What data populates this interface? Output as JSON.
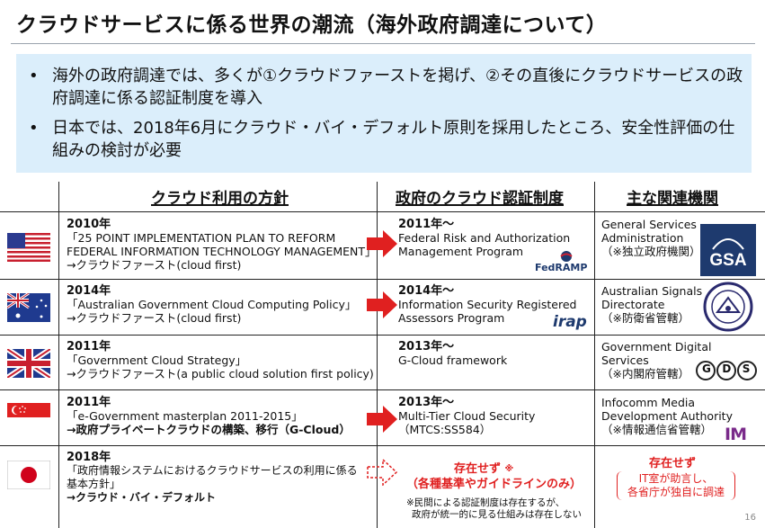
{
  "title": "クラウドサービスに係る世界の潮流（海外政府調達について）",
  "summary": {
    "bullets": [
      {
        "dot": "•",
        "text": "海外の政府調達では、多くが①クラウドファーストを掲げ、②その直後にクラウドサービスの政府調達に係る認証制度を導入"
      },
      {
        "dot": "•",
        "text": "日本では、2018年6月にクラウド・バイ・デフォルト原則を採用したところ、安全性評価の仕組みの検討が必要"
      }
    ]
  },
  "table": {
    "headers": {
      "policy": "クラウド利用の方針",
      "certification": "政府のクラウド認証制度",
      "agency": "主な関連機関"
    },
    "rows": [
      {
        "country": "usa-flag",
        "policy_year": "2010年",
        "policy_lines": [
          "「25 POINT IMPLEMENTATION PLAN TO REFORM",
          "FEDERAL INFORMATION TECHNOLOGY MANAGEMENT」",
          "→クラウドファースト(cloud first)"
        ],
        "cert_year": "2011年～",
        "cert_lines": [
          "Federal Risk and Authorization",
          "Management Program"
        ],
        "cert_logo": "FedRAMP",
        "agency_lines": [
          "General Services",
          "Administration",
          "（※独立政府機関）"
        ],
        "agency_logo": "GSA"
      },
      {
        "country": "australia-flag",
        "policy_year": "2014年",
        "policy_lines": [
          "「Australian Government Cloud Computing Policy」",
          "→クラウドファースト(cloud first)"
        ],
        "cert_year": "2014年～",
        "cert_lines": [
          "Information Security Registered",
          "Assessors Program"
        ],
        "cert_logo": "irap",
        "agency_lines": [
          "Australian Signals",
          "Directorate",
          "（※防衛省管轄）"
        ],
        "agency_logo": "ASD"
      },
      {
        "country": "uk-flag",
        "policy_year": "2011年",
        "policy_lines": [
          "「Government Cloud Strategy」",
          "→クラウドファースト(a public cloud solution first policy)"
        ],
        "cert_year": "2013年～",
        "cert_lines": [
          "G-Cloud  framework"
        ],
        "cert_logo": "",
        "agency_lines": [
          "Government Digital",
          "Services",
          "（※内閣府管轄）"
        ],
        "agency_logo": "GDS"
      },
      {
        "country": "singapore-flag",
        "policy_year": "2011年",
        "policy_lines": [
          "「e-Government masterplan 2011-2015」",
          "→政府プライベートクラウドの構築、移行（G-Cloud）"
        ],
        "cert_year": "2013年～",
        "cert_lines": [
          "Multi-Tier Cloud Security",
          "（MTCS:SS584）"
        ],
        "cert_logo": "",
        "agency_lines": [
          "Infocomm Media",
          "Development Authority",
          "（※情報通信省管轄）"
        ],
        "agency_logo": "IM"
      },
      {
        "country": "japan-flag",
        "policy_year": "2018年",
        "policy_lines": [
          "「政府情報システムにおけるクラウドサービスの利用に係る",
          "基本方針」",
          "→クラウド・バイ・デフォルト"
        ],
        "cert_status": "存在せず",
        "cert_status_mark": "※",
        "cert_detail": "（各種基準やガイドラインのみ）",
        "cert_note_lines": [
          "※民間による認証制度は存在するが、",
          "政府が統一的に見る仕組みは存在しない"
        ],
        "agency_status": "存在せず",
        "agency_detail_lines": [
          "IT室が助言し、",
          "各省庁が独自に調達"
        ]
      }
    ]
  },
  "page_number": "16",
  "colors": {
    "accent_red": "#e02020",
    "summary_bg": "#dbeefb",
    "gsa_blue": "#1e3a6e"
  }
}
